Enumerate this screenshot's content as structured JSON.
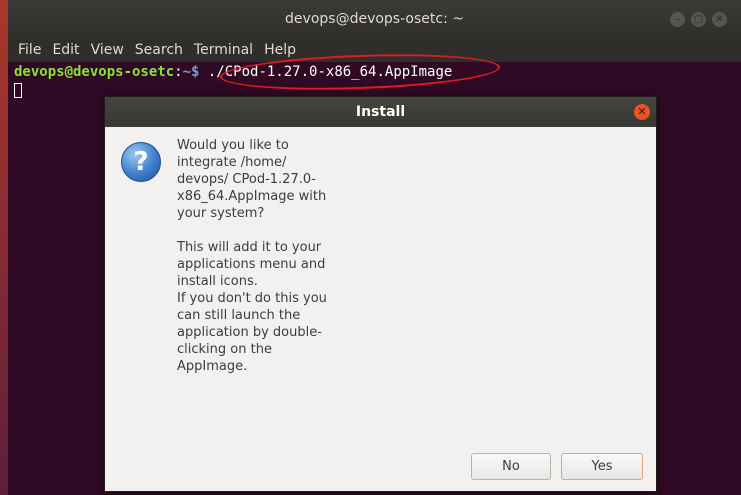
{
  "window": {
    "title": "devops@devops-osetc: ~",
    "controls": [
      "minimize",
      "maximize",
      "close"
    ]
  },
  "menu": [
    "File",
    "Edit",
    "View",
    "Search",
    "Terminal",
    "Help"
  ],
  "terminal": {
    "prompt_user": "devops@devops-osetc",
    "prompt_sep": ":",
    "prompt_path": "~$",
    "command": " ./CPod-1.27.0-x86_64.AppImage",
    "highlight_color": "#e01b24"
  },
  "dialog": {
    "title": "Install",
    "icon": "question-icon",
    "question": "Would you like to integrate /home/ devops/ CPod-1.27.0- x86_64.AppImage with your system?",
    "info_1": "This will add it to your applications menu and install icons.",
    "info_2": "If you don't do this you can still launch the application by double-clicking on the AppImage.",
    "buttons": {
      "no": "No",
      "yes": "Yes"
    }
  }
}
